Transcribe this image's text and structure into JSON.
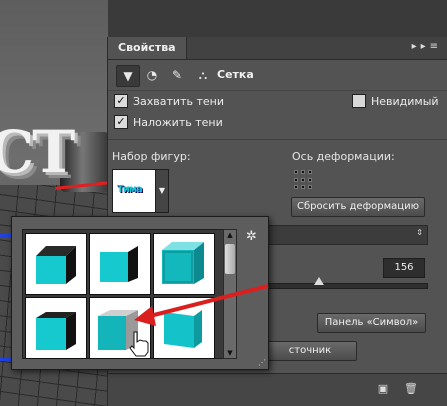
{
  "panel": {
    "tab_title": "Свойства",
    "header_icons": [
      "collapse-icon",
      "menu-icon"
    ],
    "toolbar_label": "Сетка"
  },
  "options": {
    "capture_shadows": {
      "label": "Захватить тени",
      "checked": true
    },
    "cast_shadows": {
      "label": "Наложить тени",
      "checked": true
    },
    "invisible": {
      "label": "Невидимый",
      "checked": false
    }
  },
  "shape_preset": {
    "label": "Набор фигур:",
    "thumb_text": "Тима"
  },
  "deformation": {
    "label": "Ось деформации:",
    "reset_button": "Сбросить деформацию"
  },
  "value_field": "156",
  "slider_value": 0.33,
  "buttons": {
    "character_panel": "Панель «Символ»",
    "source_partial": "сточник"
  },
  "colors": {
    "cube_cyan": "#16c9cf",
    "arrow": "#d9201f",
    "panel_bg": "#535353"
  }
}
